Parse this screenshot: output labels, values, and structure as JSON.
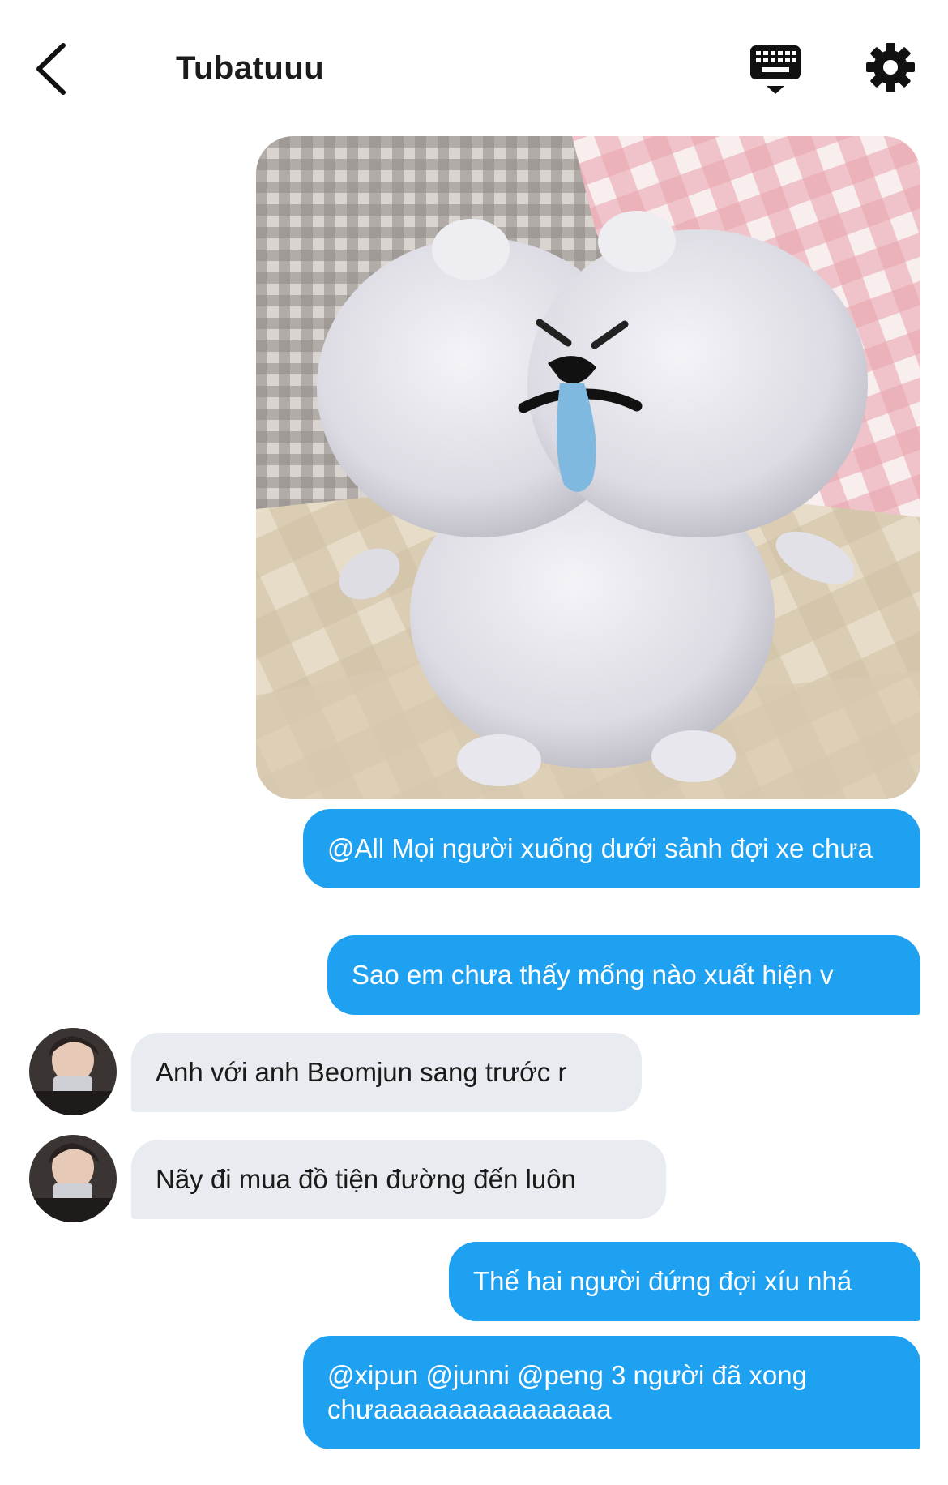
{
  "header": {
    "title": "Tubatuuu",
    "back_icon": "chevron-left-icon",
    "keyboard_icon": "keyboard-icon",
    "settings_icon": "gear-icon"
  },
  "messages": [
    {
      "type": "image",
      "direction": "outgoing",
      "description_icon": "photo-plush-toy"
    },
    {
      "type": "text",
      "direction": "outgoing",
      "text": "@All Mọi người xuống dưới sảnh đợi xe chưa"
    },
    {
      "type": "text",
      "direction": "outgoing",
      "text": "Sao em chưa thấy mống nào xuất hiện v"
    },
    {
      "type": "text",
      "direction": "incoming",
      "text": "Anh với anh Beomjun sang trước r"
    },
    {
      "type": "text",
      "direction": "incoming",
      "text": "Nãy đi mua đồ tiện đường đến luôn"
    },
    {
      "type": "text",
      "direction": "outgoing",
      "text": "Thế hai người đứng đợi xíu nhá"
    },
    {
      "type": "text",
      "direction": "outgoing",
      "text": "@xipun @junni @peng 3 người đã xong chưaaaaaaaaaaaaaaaa"
    }
  ],
  "colors": {
    "outgoing_bubble": "#1ea1f1",
    "incoming_bubble": "#e8ebef",
    "background": "#ffffff"
  }
}
